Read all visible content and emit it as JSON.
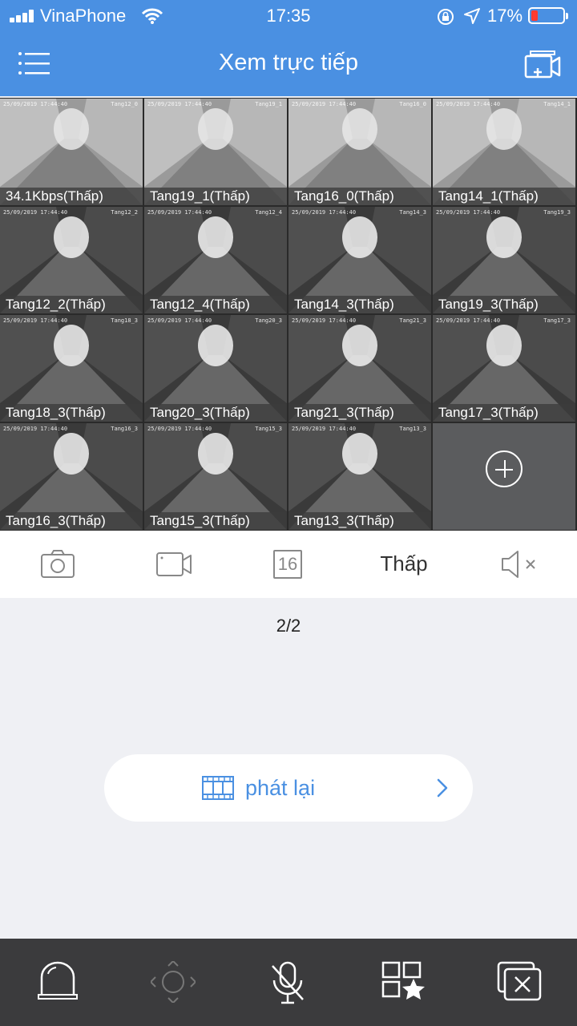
{
  "status_bar": {
    "carrier": "VinaPhone",
    "time": "17:35",
    "battery": "17%"
  },
  "header": {
    "title": "Xem trực tiếp"
  },
  "cameras": [
    {
      "label": "34.1Kbps(Thấp)",
      "osd_date": "25/09/2019 17:44:40",
      "osd_name": "Tang12_0",
      "selected": true
    },
    {
      "label": "Tang19_1(Thấp)",
      "osd_date": "25/09/2019 17:44:40",
      "osd_name": "Tang19_1"
    },
    {
      "label": "Tang16_0(Thấp)",
      "osd_date": "25/09/2019 17:44:40",
      "osd_name": "Tang16_0"
    },
    {
      "label": "Tang14_1(Thấp)",
      "osd_date": "25/09/2019 17:44:40",
      "osd_name": "Tang14_1"
    },
    {
      "label": "Tang12_2(Thấp)",
      "osd_date": "25/09/2019 17:44:40",
      "osd_name": "Tang12_2"
    },
    {
      "label": "Tang12_4(Thấp)",
      "osd_date": "25/09/2019 17:44:40",
      "osd_name": "Tang12_4"
    },
    {
      "label": "Tang14_3(Thấp)",
      "osd_date": "25/09/2019 17:44:40",
      "osd_name": "Tang14_3"
    },
    {
      "label": "Tang19_3(Thấp)",
      "osd_date": "25/09/2019 17:44:40",
      "osd_name": "Tang19_3"
    },
    {
      "label": "Tang18_3(Thấp)",
      "osd_date": "25/09/2019 17:44:40",
      "osd_name": "Tang18_3"
    },
    {
      "label": "Tang20_3(Thấp)",
      "osd_date": "25/09/2019 17:44:40",
      "osd_name": "Tang20_3"
    },
    {
      "label": "Tang21_3(Thấp)",
      "osd_date": "25/09/2019 17:44:40",
      "osd_name": "Tang21_3"
    },
    {
      "label": "Tang17_3(Thấp)",
      "osd_date": "25/09/2019 17:44:40",
      "osd_name": "Tang17_3"
    },
    {
      "label": "Tang16_3(Thấp)",
      "osd_date": "25/09/2019 17:44:40",
      "osd_name": "Tang16_3"
    },
    {
      "label": "Tang15_3(Thấp)",
      "osd_date": "25/09/2019 17:44:40",
      "osd_name": "Tang15_3"
    },
    {
      "label": "Tang13_3(Thấp)",
      "osd_date": "25/09/2019 17:44:40",
      "osd_name": "Tang13_3"
    }
  ],
  "toolbar": {
    "split_count": "16",
    "quality": "Thấp"
  },
  "pager": {
    "text": "2/2"
  },
  "playback": {
    "label": "phát lại"
  },
  "colors": {
    "header": "#4a90e2",
    "accent": "#4a90e2",
    "bottom_bar": "#3b3b3d"
  },
  "icons": {
    "header": [
      "menu-icon",
      "add-camera-icon"
    ],
    "toolbar": [
      "camera-icon",
      "video-record-icon",
      "split-16-icon",
      "mute-icon"
    ],
    "bottom": [
      "alarm-icon",
      "ptz-icon",
      "mic-off-icon",
      "favorites-icon",
      "close-all-icon"
    ]
  }
}
